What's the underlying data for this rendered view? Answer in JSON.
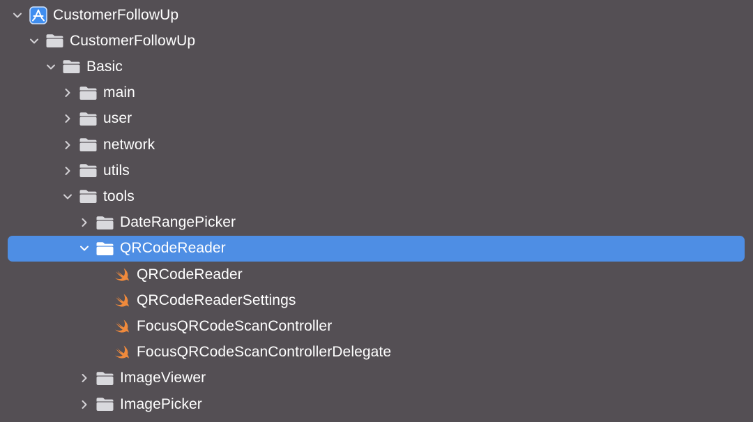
{
  "navigator": {
    "items": [
      {
        "label": "CustomerFollowUp",
        "kind": "project",
        "icon": "xcode-project-icon",
        "depth": 0,
        "expanded": true
      },
      {
        "label": "CustomerFollowUp",
        "kind": "folder",
        "icon": "folder-icon",
        "depth": 1,
        "expanded": true
      },
      {
        "label": "Basic",
        "kind": "folder",
        "icon": "folder-icon",
        "depth": 2,
        "expanded": true
      },
      {
        "label": "main",
        "kind": "folder",
        "icon": "folder-icon",
        "depth": 3,
        "expanded": false
      },
      {
        "label": "user",
        "kind": "folder",
        "icon": "folder-icon",
        "depth": 3,
        "expanded": false
      },
      {
        "label": "network",
        "kind": "folder",
        "icon": "folder-icon",
        "depth": 3,
        "expanded": false
      },
      {
        "label": "utils",
        "kind": "folder",
        "icon": "folder-icon",
        "depth": 3,
        "expanded": false
      },
      {
        "label": "tools",
        "kind": "folder",
        "icon": "folder-icon",
        "depth": 3,
        "expanded": true
      },
      {
        "label": "DateRangePicker",
        "kind": "folder",
        "icon": "folder-icon",
        "depth": 4,
        "expanded": false
      },
      {
        "label": "QRCodeReader",
        "kind": "folder",
        "icon": "folder-icon",
        "depth": 4,
        "expanded": true,
        "selected": true
      },
      {
        "label": "QRCodeReader",
        "kind": "file",
        "icon": "swift-file-icon",
        "depth": 5
      },
      {
        "label": "QRCodeReaderSettings",
        "kind": "file",
        "icon": "swift-file-icon",
        "depth": 5
      },
      {
        "label": "FocusQRCodeScanController",
        "kind": "file",
        "icon": "swift-file-icon",
        "depth": 5
      },
      {
        "label": "FocusQRCodeScanControllerDelegate",
        "kind": "file",
        "icon": "swift-file-icon",
        "depth": 5
      },
      {
        "label": "ImageViewer",
        "kind": "folder",
        "icon": "folder-icon",
        "depth": 4,
        "expanded": false
      },
      {
        "label": "ImagePicker",
        "kind": "folder",
        "icon": "folder-icon",
        "depth": 4,
        "expanded": false
      }
    ]
  },
  "colors": {
    "background": "#544f54",
    "selection": "#4e8ee4",
    "text": "#ffffff",
    "folder": "#d9d9dd",
    "folder_selected": "#ffffff",
    "disclosure": "#d4d2d6",
    "swift": "#f08a3c",
    "project_icon": "#3f8ef0"
  }
}
